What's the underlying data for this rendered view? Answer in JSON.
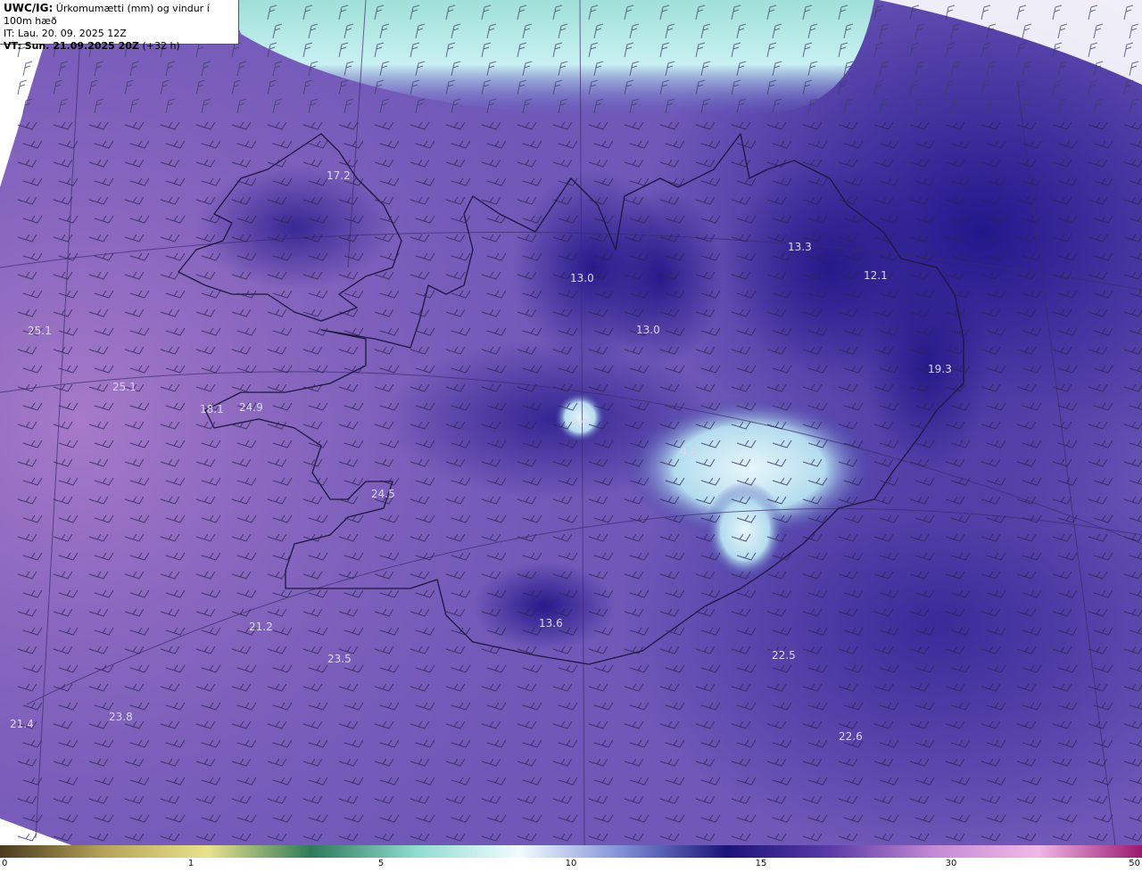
{
  "header": {
    "title_code": "UWC/IG:",
    "title_desc": "Úrkomumætti (mm) og vindur í 100m hæð",
    "initial_time": "IT: Lau. 20. 09. 2025 12Z",
    "valid_label": "VT: Sun. 21.09.2025 20Z",
    "valid_offset": "(+32 h)"
  },
  "map": {
    "background_color": "#7a5cb8",
    "ocean_west_color": "#9a70c4",
    "north_band_color": "#aee8e2",
    "dense_color": "#2c1f8e",
    "icecap_color": "#d8eef6",
    "labels": [
      {
        "text": "17.2"
      },
      {
        "text": "25.1"
      },
      {
        "text": "25.1"
      },
      {
        "text": "18.1"
      },
      {
        "text": "24.9"
      },
      {
        "text": "24.5"
      },
      {
        "text": "13.0"
      },
      {
        "text": "13.0"
      },
      {
        "text": "13.3"
      },
      {
        "text": "12.1"
      },
      {
        "text": "19.3"
      },
      {
        "text": "9.9"
      },
      {
        "text": "9.6"
      },
      {
        "text": "13.6"
      },
      {
        "text": "21.2"
      },
      {
        "text": "23.5"
      },
      {
        "text": "22.5"
      },
      {
        "text": "21.4"
      },
      {
        "text": "23.8"
      },
      {
        "text": "22.6"
      }
    ]
  },
  "colorbar": {
    "ticks": [
      "0",
      "1",
      "5",
      "10",
      "15",
      "30",
      "50"
    ],
    "stops": [
      "#4a3a1c",
      "#b6a35a",
      "#e9e28c",
      "#2e7a5a",
      "#8fdcd0",
      "#f2fcff",
      "#7f8fd6",
      "#1c1478",
      "#5a3aa8",
      "#c48ad4",
      "#f0b8e8",
      "#9a1870"
    ]
  }
}
